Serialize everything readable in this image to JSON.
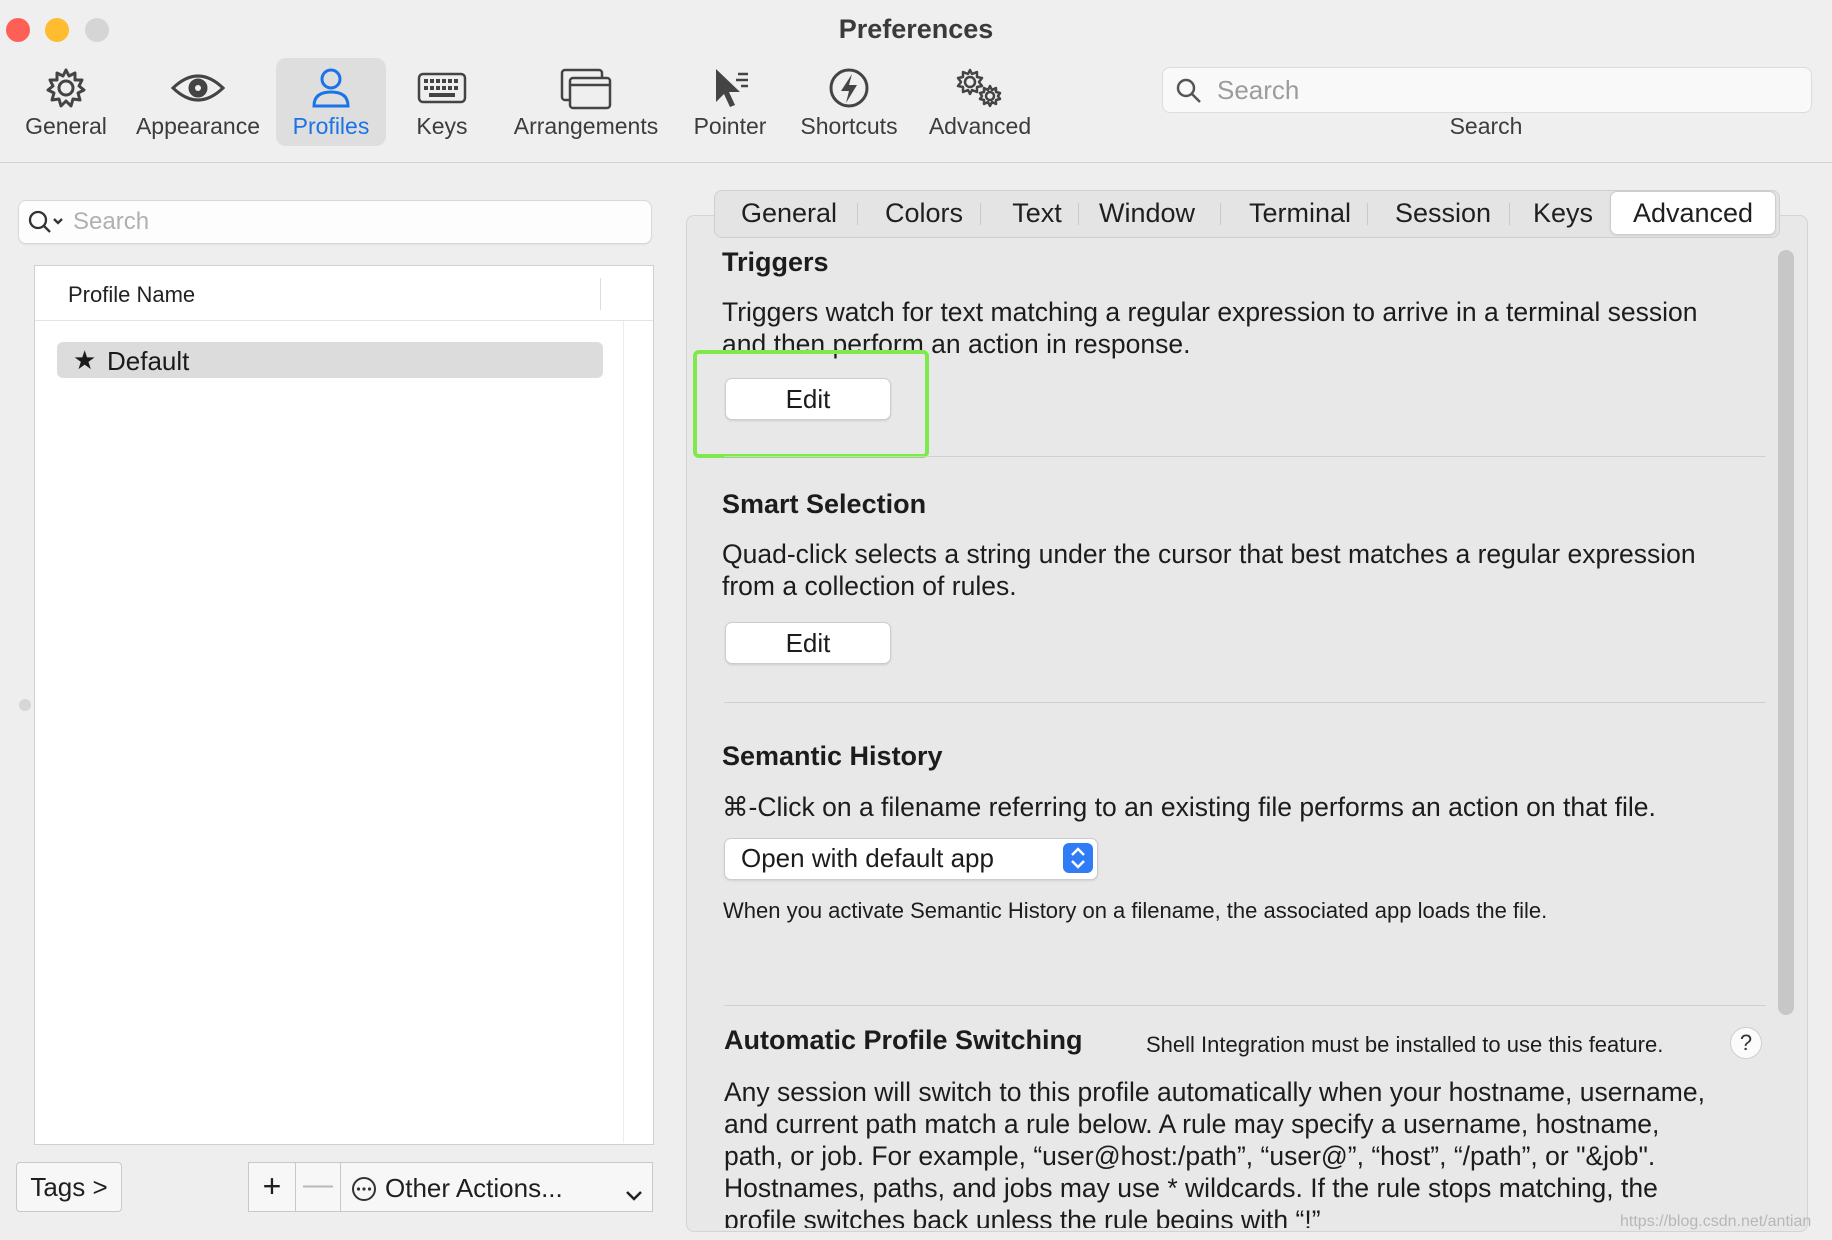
{
  "window": {
    "title": "Preferences",
    "traffic_colors": {
      "close": "#fe5f57",
      "minimize": "#febc2e",
      "zoom": "#d5d5d5"
    }
  },
  "toolbar": {
    "items": [
      {
        "label": "General",
        "icon": "gear-icon"
      },
      {
        "label": "Appearance",
        "icon": "eye-icon"
      },
      {
        "label": "Profiles",
        "icon": "person-icon",
        "active": true
      },
      {
        "label": "Keys",
        "icon": "keyboard-icon"
      },
      {
        "label": "Arrangements",
        "icon": "windows-icon"
      },
      {
        "label": "Pointer",
        "icon": "cursor-icon"
      },
      {
        "label": "Shortcuts",
        "icon": "bolt-icon"
      },
      {
        "label": "Advanced",
        "icon": "gears-icon"
      }
    ],
    "search": {
      "placeholder": "Search",
      "caption": "Search"
    },
    "accent_color": "#1a73e8"
  },
  "profiles_panel": {
    "search_placeholder": "Search",
    "column_header": "Profile Name",
    "profiles": [
      {
        "name": "Default",
        "default": true,
        "selected": true
      }
    ],
    "tags_button": "Tags >",
    "add_button": "+",
    "remove_button": "—",
    "other_actions": "Other Actions..."
  },
  "tabs": {
    "items": [
      "General",
      "Colors",
      "Text",
      "Window",
      "Terminal",
      "Session",
      "Keys",
      "Advanced"
    ],
    "active": "Advanced"
  },
  "sections": {
    "triggers": {
      "title": "Triggers",
      "line1": "Triggers watch for text matching a regular expression to arrive in a terminal session",
      "line2": "and then perform an action in response.",
      "button": "Edit"
    },
    "smart_selection": {
      "title": "Smart Selection",
      "line1": "Quad-click selects a string under the cursor that best matches a regular expression",
      "line2": "from a collection of rules.",
      "button": "Edit"
    },
    "semantic_history": {
      "title": "Semantic History",
      "description": "⌘-Click on a filename referring to an existing file performs an action on that file.",
      "selected_option": "Open with default app",
      "note": "When you activate Semantic History on a filename, the associated app loads the file."
    },
    "automatic_profile_switching": {
      "title": "Automatic Profile Switching",
      "note": "Shell Integration must be installed to use this feature.",
      "help": "?",
      "lines": [
        "Any session will switch to this profile automatically when your hostname, username,",
        "and current path match a rule below. A rule may specify a username, hostname,",
        "path, or job. For example, “user@host:/path”, “user@”, “host”, “/path”, or \"&job\".",
        "Hostnames, paths, and jobs may use * wildcards. If the rule stops matching, the",
        "profile switches back unless the rule begins with “!”"
      ]
    }
  },
  "highlight_color": "#7fe84c",
  "watermark": "https://blog.csdn.net/antian"
}
